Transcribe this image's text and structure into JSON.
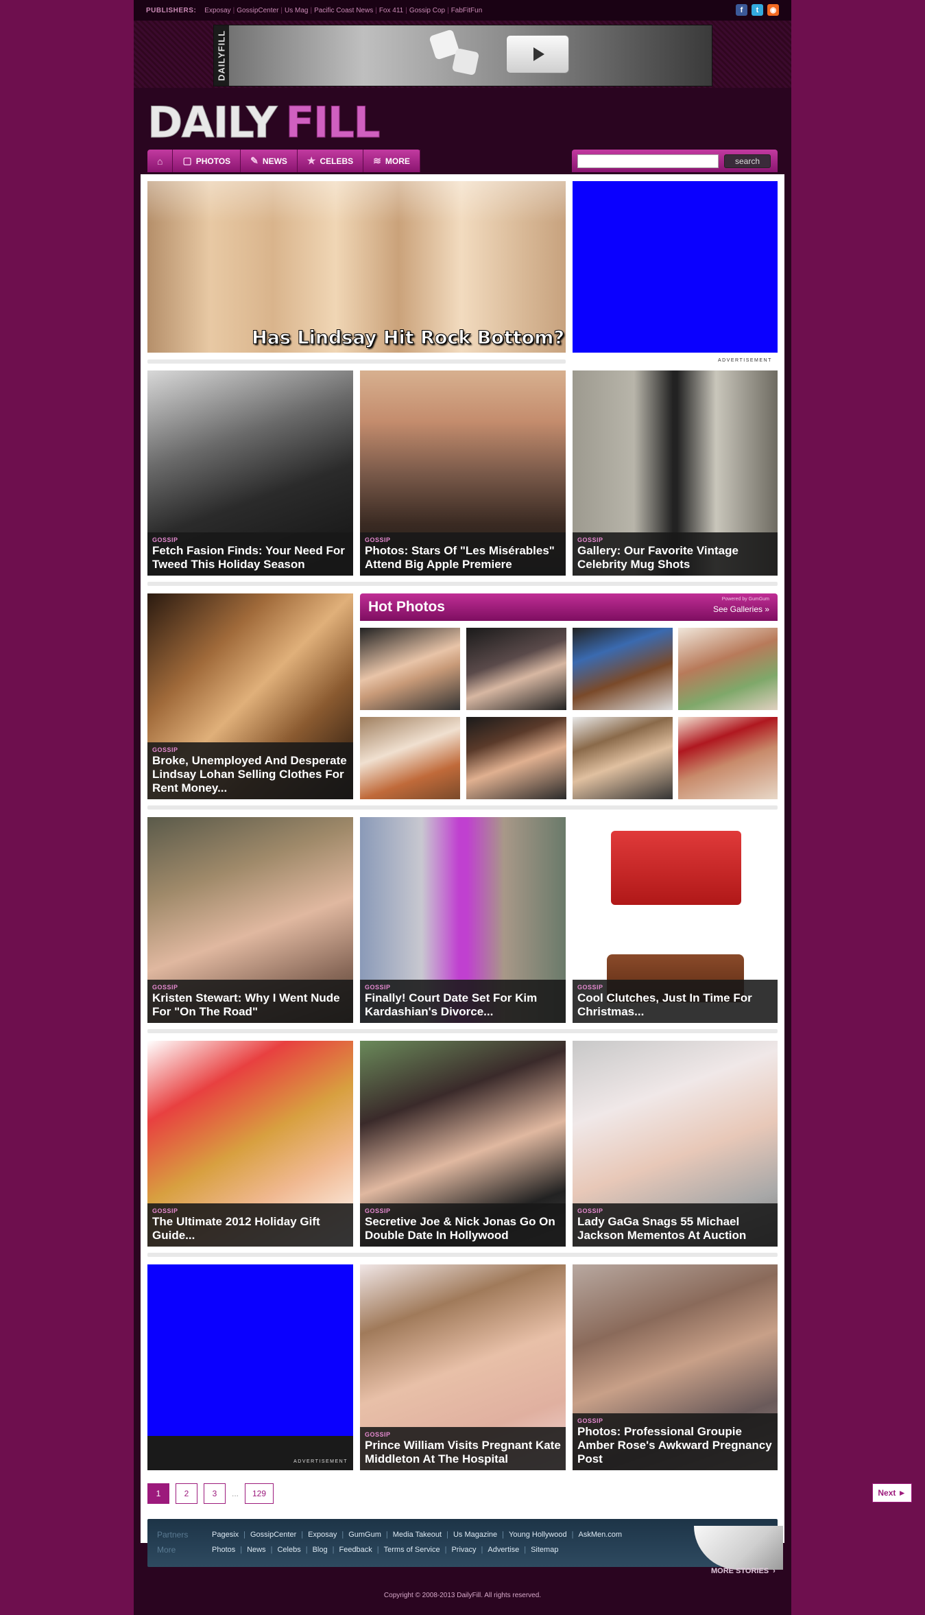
{
  "topbar": {
    "label": "PUBLISHERS:",
    "publishers": [
      "Exposay",
      "GossipCenter",
      "Us Mag",
      "Pacific Coast News",
      "Fox 411",
      "Gossip Cop",
      "FabFitFun"
    ],
    "social": [
      {
        "name": "facebook-icon",
        "glyph": "f"
      },
      {
        "name": "twitter-icon",
        "glyph": "t"
      },
      {
        "name": "rss-icon",
        "glyph": "◉"
      }
    ]
  },
  "banner": {
    "side_text": "DAILYFILL"
  },
  "logo": {
    "part1": "DAILY",
    "part2": "FILL"
  },
  "nav": {
    "home_icon": "⌂",
    "items": [
      {
        "label": "PHOTOS",
        "icon": "▢"
      },
      {
        "label": "NEWS",
        "icon": "✎"
      },
      {
        "label": "CELEBS",
        "icon": "★"
      },
      {
        "label": "MORE",
        "icon": "≋"
      }
    ]
  },
  "search": {
    "value": "",
    "button": "search"
  },
  "hero": {
    "overlay": "Has Lindsay Hit Rock Bottom?"
  },
  "ad_label": "ADVERTISEMENT",
  "row1": [
    {
      "tag": "GOSSIP",
      "title": "Fetch Fasion Finds: Your Need For Tweed This Holiday Season"
    },
    {
      "tag": "GOSSIP",
      "title": "Photos: Stars Of \"Les Misérables\" Attend Big Apple Premiere"
    },
    {
      "tag": "GOSSIP",
      "title": "Gallery: Our Favorite Vintage Celebrity Mug Shots"
    }
  ],
  "lohan_story": {
    "tag": "GOSSIP",
    "title": "Broke, Unemployed And Desperate Lindsay Lohan Selling Clothes For Rent Money..."
  },
  "hot_photos": {
    "title": "Hot Photos",
    "powered": "Powered by GumGum",
    "see_all": "See Galleries »"
  },
  "row3": [
    {
      "tag": "GOSSIP",
      "title": "Kristen Stewart: Why I Went Nude For \"On The Road\""
    },
    {
      "tag": "GOSSIP",
      "title": "Finally! Court Date Set For Kim Kardashian's Divorce..."
    },
    {
      "tag": "GOSSIP",
      "title": "Cool Clutches, Just In Time For Christmas..."
    }
  ],
  "row4": [
    {
      "tag": "GOSSIP",
      "title": "The Ultimate 2012 Holiday Gift Guide..."
    },
    {
      "tag": "GOSSIP",
      "title": "Secretive Joe & Nick Jonas Go On Double Date In Hollywood"
    },
    {
      "tag": "GOSSIP",
      "title": "Lady GaGa Snags 55 Michael Jackson Mementos At Auction"
    }
  ],
  "row5": [
    {
      "tag": "GOSSIP",
      "title": "Prince William Visits Pregnant Kate Middleton At The Hospital"
    },
    {
      "tag": "GOSSIP",
      "title": "Photos: Professional Groupie Amber Rose's Awkward Pregnancy Post"
    }
  ],
  "pagination": {
    "pages": [
      "1",
      "2",
      "3"
    ],
    "ellipsis": "...",
    "last": "129",
    "next": "Next ►"
  },
  "footer": {
    "partners_label": "Partners",
    "partners": [
      "Pagesix",
      "GossipCenter",
      "Exposay",
      "GumGum",
      "Media Takeout",
      "Us Magazine",
      "Young Hollywood",
      "AskMen.com"
    ],
    "more_label": "More",
    "more": [
      "Photos",
      "News",
      "Celebs",
      "Blog",
      "Feedback",
      "Terms of Service",
      "Privacy",
      "Advertise",
      "Sitemap"
    ],
    "more_stories": "MORE STORIES",
    "copyright": "Copyright © 2008-2013 DailyFill. All rights reserved."
  },
  "colors": {
    "background": "#6e0f4e",
    "accent": "#9c1a7c",
    "ad": "#0a00ff"
  }
}
